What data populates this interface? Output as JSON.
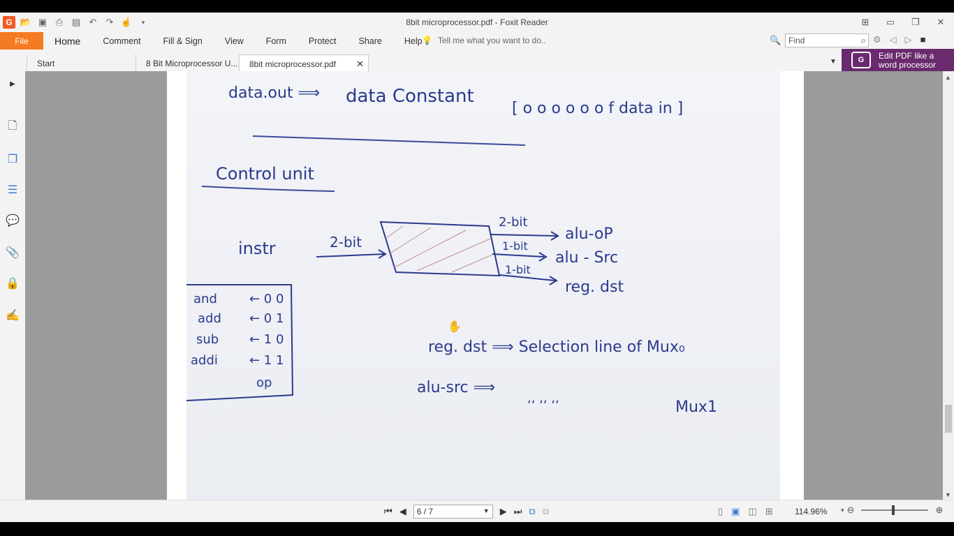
{
  "window": {
    "title": "8bit microprocessor.pdf - Foxit Reader"
  },
  "ribbon": {
    "file": "File",
    "menus": [
      "Home",
      "Comment",
      "Fill & Sign",
      "View",
      "Form",
      "Protect",
      "Share",
      "Help"
    ],
    "tell_me": "Tell me what you want to do..",
    "find_placeholder": "Find"
  },
  "tabs": [
    {
      "label": "Start"
    },
    {
      "label": "8 Bit Microprocessor U..."
    },
    {
      "label": "8bit microprocessor.pdf"
    }
  ],
  "promo": {
    "line1": "Edit PDF like a",
    "line2": "word processor"
  },
  "document": {
    "line1": {
      "left": "data.out ⟹",
      "middle": "data Constant",
      "bracket": "[ o o o o o o  f data in ]"
    },
    "heading": "Control unit",
    "input_label": "instr",
    "input_bits": "2-bit",
    "outputs": [
      {
        "bits": "2-bit",
        "name": "alu-oP"
      },
      {
        "bits": "1-bit",
        "name": "alu - Src"
      },
      {
        "bits": "1-bit",
        "name": "reg. dst"
      }
    ],
    "opcode_table": [
      {
        "op": "and",
        "code": "← 0 0"
      },
      {
        "op": "add",
        "code": "← 0 1"
      },
      {
        "op": "sub",
        "code": "← 1 0"
      },
      {
        "op": "addi",
        "code": "← 1 1"
      }
    ],
    "opcode_footer": "op",
    "note1": "reg. dst ⟹ Selection line of Mux₀",
    "note2_left": "alu-src ⟹",
    "note2_marks": ",,          ,,          ,,",
    "note2_right": "Mux1"
  },
  "status": {
    "page": "6 / 7",
    "zoom": "114.96%"
  }
}
